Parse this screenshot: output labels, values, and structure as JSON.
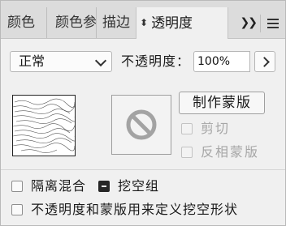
{
  "tabs": [
    {
      "label": "颜色",
      "active": false
    },
    {
      "label": "颜色参",
      "active": false
    },
    {
      "label": "描边",
      "active": false
    },
    {
      "label": "透明度",
      "active": true
    }
  ],
  "tab_overflow": "»",
  "blend_mode": {
    "value": "正常"
  },
  "opacity": {
    "label": "不透明度：",
    "value": "100%"
  },
  "make_mask_button": "制作蒙版",
  "clip": {
    "label": "剪切",
    "checked": false,
    "disabled": true
  },
  "invert_mask": {
    "label": "反相蒙版",
    "checked": false,
    "disabled": true
  },
  "isolate_blending": {
    "label": "隔离混合",
    "checked": false
  },
  "knockout_group": {
    "label": "挖空组",
    "checked": true
  },
  "opacity_mask_knockout": {
    "label": "不透明度和蒙版用来定义挖空形状",
    "checked": false
  },
  "colors": {
    "panel_bg": "#f0f0f0",
    "tab_bg": "#dcdcdc",
    "disabled_text": "#a6a6a6"
  }
}
